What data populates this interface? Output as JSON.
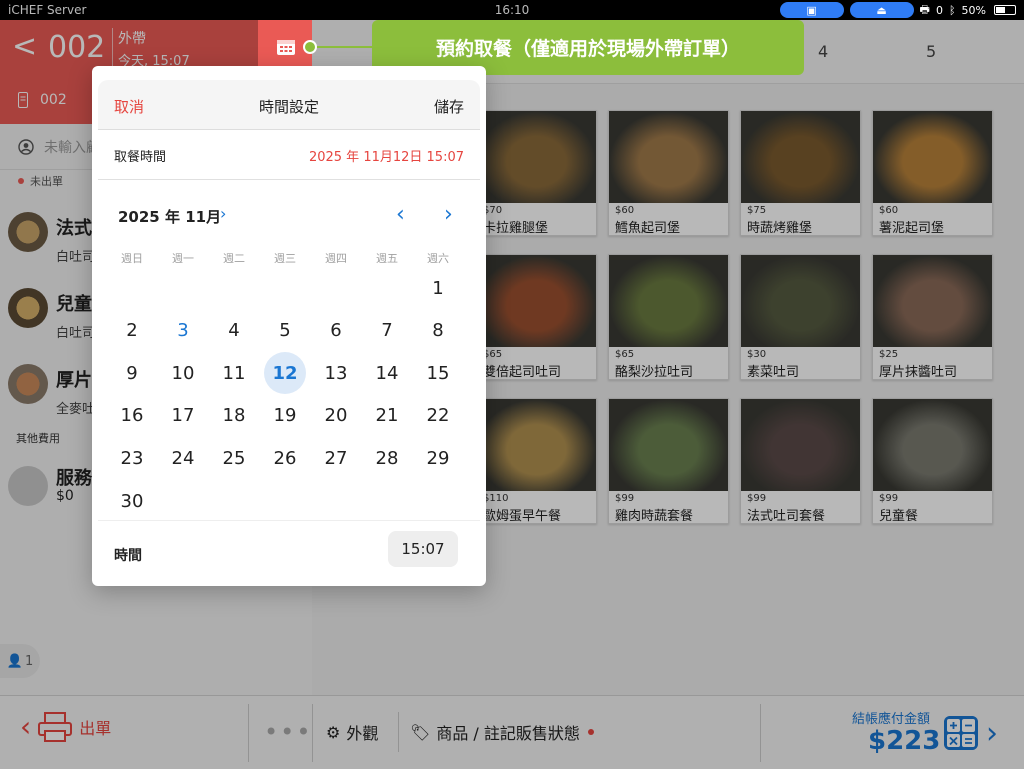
{
  "statusbar": {
    "carrier": "iCHEF Server",
    "time": "16:10",
    "battery_label": "50%",
    "printer_count": "0"
  },
  "order": {
    "back": "<",
    "number": "002",
    "type": "外帶",
    "time": "今天, 15:07",
    "ticket": "002",
    "customer_placeholder": "未輸入顧",
    "unsent": "未出單"
  },
  "items": [
    {
      "name": "法式吐",
      "sub": "白吐司"
    },
    {
      "name": "兒童餐",
      "sub": "白吐司"
    },
    {
      "name": "厚片抹",
      "sub": "全麥吐"
    }
  ],
  "other_fees_label": "其他費用",
  "fee": {
    "name": "服務費",
    "amount": "$0"
  },
  "guest_count": "1",
  "tabs": [
    "4",
    "5"
  ],
  "products": [
    {
      "price": "$70",
      "name": "卡拉雞腿堡",
      "color": "#8a6a3a"
    },
    {
      "price": "$60",
      "name": "鱈魚起司堡",
      "color": "#a07a4a"
    },
    {
      "price": "$75",
      "name": "時蔬烤雞堡",
      "color": "#7a5a2e"
    },
    {
      "price": "$60",
      "name": "薯泥起司堡",
      "color": "#b8823a"
    },
    {
      "price": "$65",
      "name": "雙倍起司吐司",
      "color": "#9a5030"
    },
    {
      "price": "$65",
      "name": "酪梨沙拉吐司",
      "color": "#6a7a40"
    },
    {
      "price": "$30",
      "name": "素菜吐司",
      "color": "#555a40"
    },
    {
      "price": "$25",
      "name": "厚片抹醬吐司",
      "color": "#8a6a58"
    },
    {
      "price": "$110",
      "name": "歐姆蛋早午餐",
      "color": "#b09050"
    },
    {
      "price": "$99",
      "name": "雞肉時蔬套餐",
      "color": "#6a8050"
    },
    {
      "price": "$99",
      "name": "法式吐司套餐",
      "color": "#5a4a48"
    },
    {
      "price": "$99",
      "name": "兒童餐",
      "color": "#7a7a70"
    }
  ],
  "bottom": {
    "print_label": "出單",
    "more": "•••",
    "look_label": "外觀",
    "product_label": "商品 / 註記販售狀態",
    "total_label": "結帳應付金額",
    "total": "$223"
  },
  "tooltip": "預約取餐（僅適用於現場外帶訂單）",
  "picker": {
    "cancel": "取消",
    "title": "時間設定",
    "save": "儲存",
    "pickup_label": "取餐時間",
    "pickup_value": "2025 年 11月12日 15:07",
    "month": "2025 年 11月",
    "weekdays": [
      "週日",
      "週一",
      "週二",
      "週三",
      "週四",
      "週五",
      "週六"
    ],
    "first_weekday": 6,
    "days_in_month": 30,
    "today_day": 3,
    "selected_day": 12,
    "time_label": "時間",
    "time_value": "15:07"
  }
}
